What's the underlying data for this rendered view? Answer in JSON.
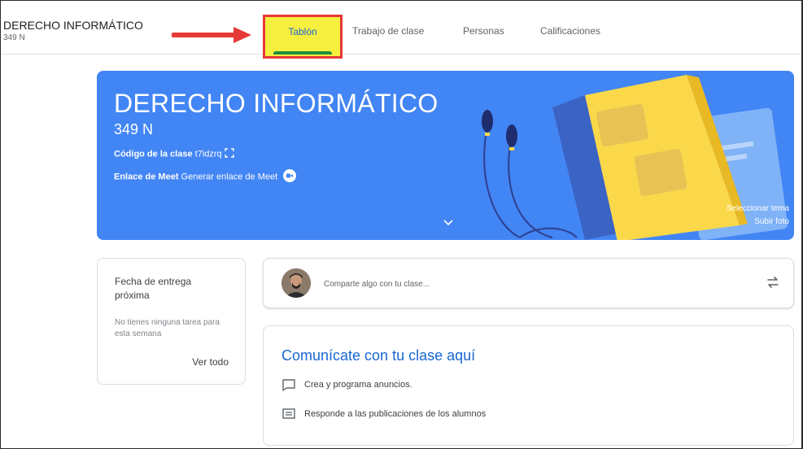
{
  "header": {
    "course_title": "DERECHO INFORMÁTICO",
    "course_section": "349 N",
    "tabs": [
      {
        "label": "Tablón",
        "active": true
      },
      {
        "label": "Trabajo de clase"
      },
      {
        "label": "Personas"
      },
      {
        "label": "Calificaciones"
      }
    ],
    "highlight_color": "#f7ef3f",
    "annotation_color": "#e53935"
  },
  "banner": {
    "title": "DERECHO INFORMÁTICO",
    "section": "349 N",
    "class_code_label": "Código de la clase",
    "class_code_value": "t7idzrq",
    "meet_label": "Enlace de Meet",
    "meet_value": "Generar enlace de Meet",
    "select_theme": "Seleccionar tema",
    "upload_photo": "Subir foto",
    "color": "#4285f4"
  },
  "upcoming": {
    "title": "Fecha de entrega próxima",
    "empty_text": "No tienes ninguna tarea para esta semana",
    "view_all": "Ver todo"
  },
  "share": {
    "placeholder": "Comparte algo con tu clase..."
  },
  "info": {
    "title": "Comunícate con tu clase aquí",
    "items": [
      {
        "icon": "chat-bubble-icon",
        "text": "Crea y programa anuncios."
      },
      {
        "icon": "forum-icon",
        "text": "Responde a las publicaciones de los alumnos"
      }
    ]
  }
}
